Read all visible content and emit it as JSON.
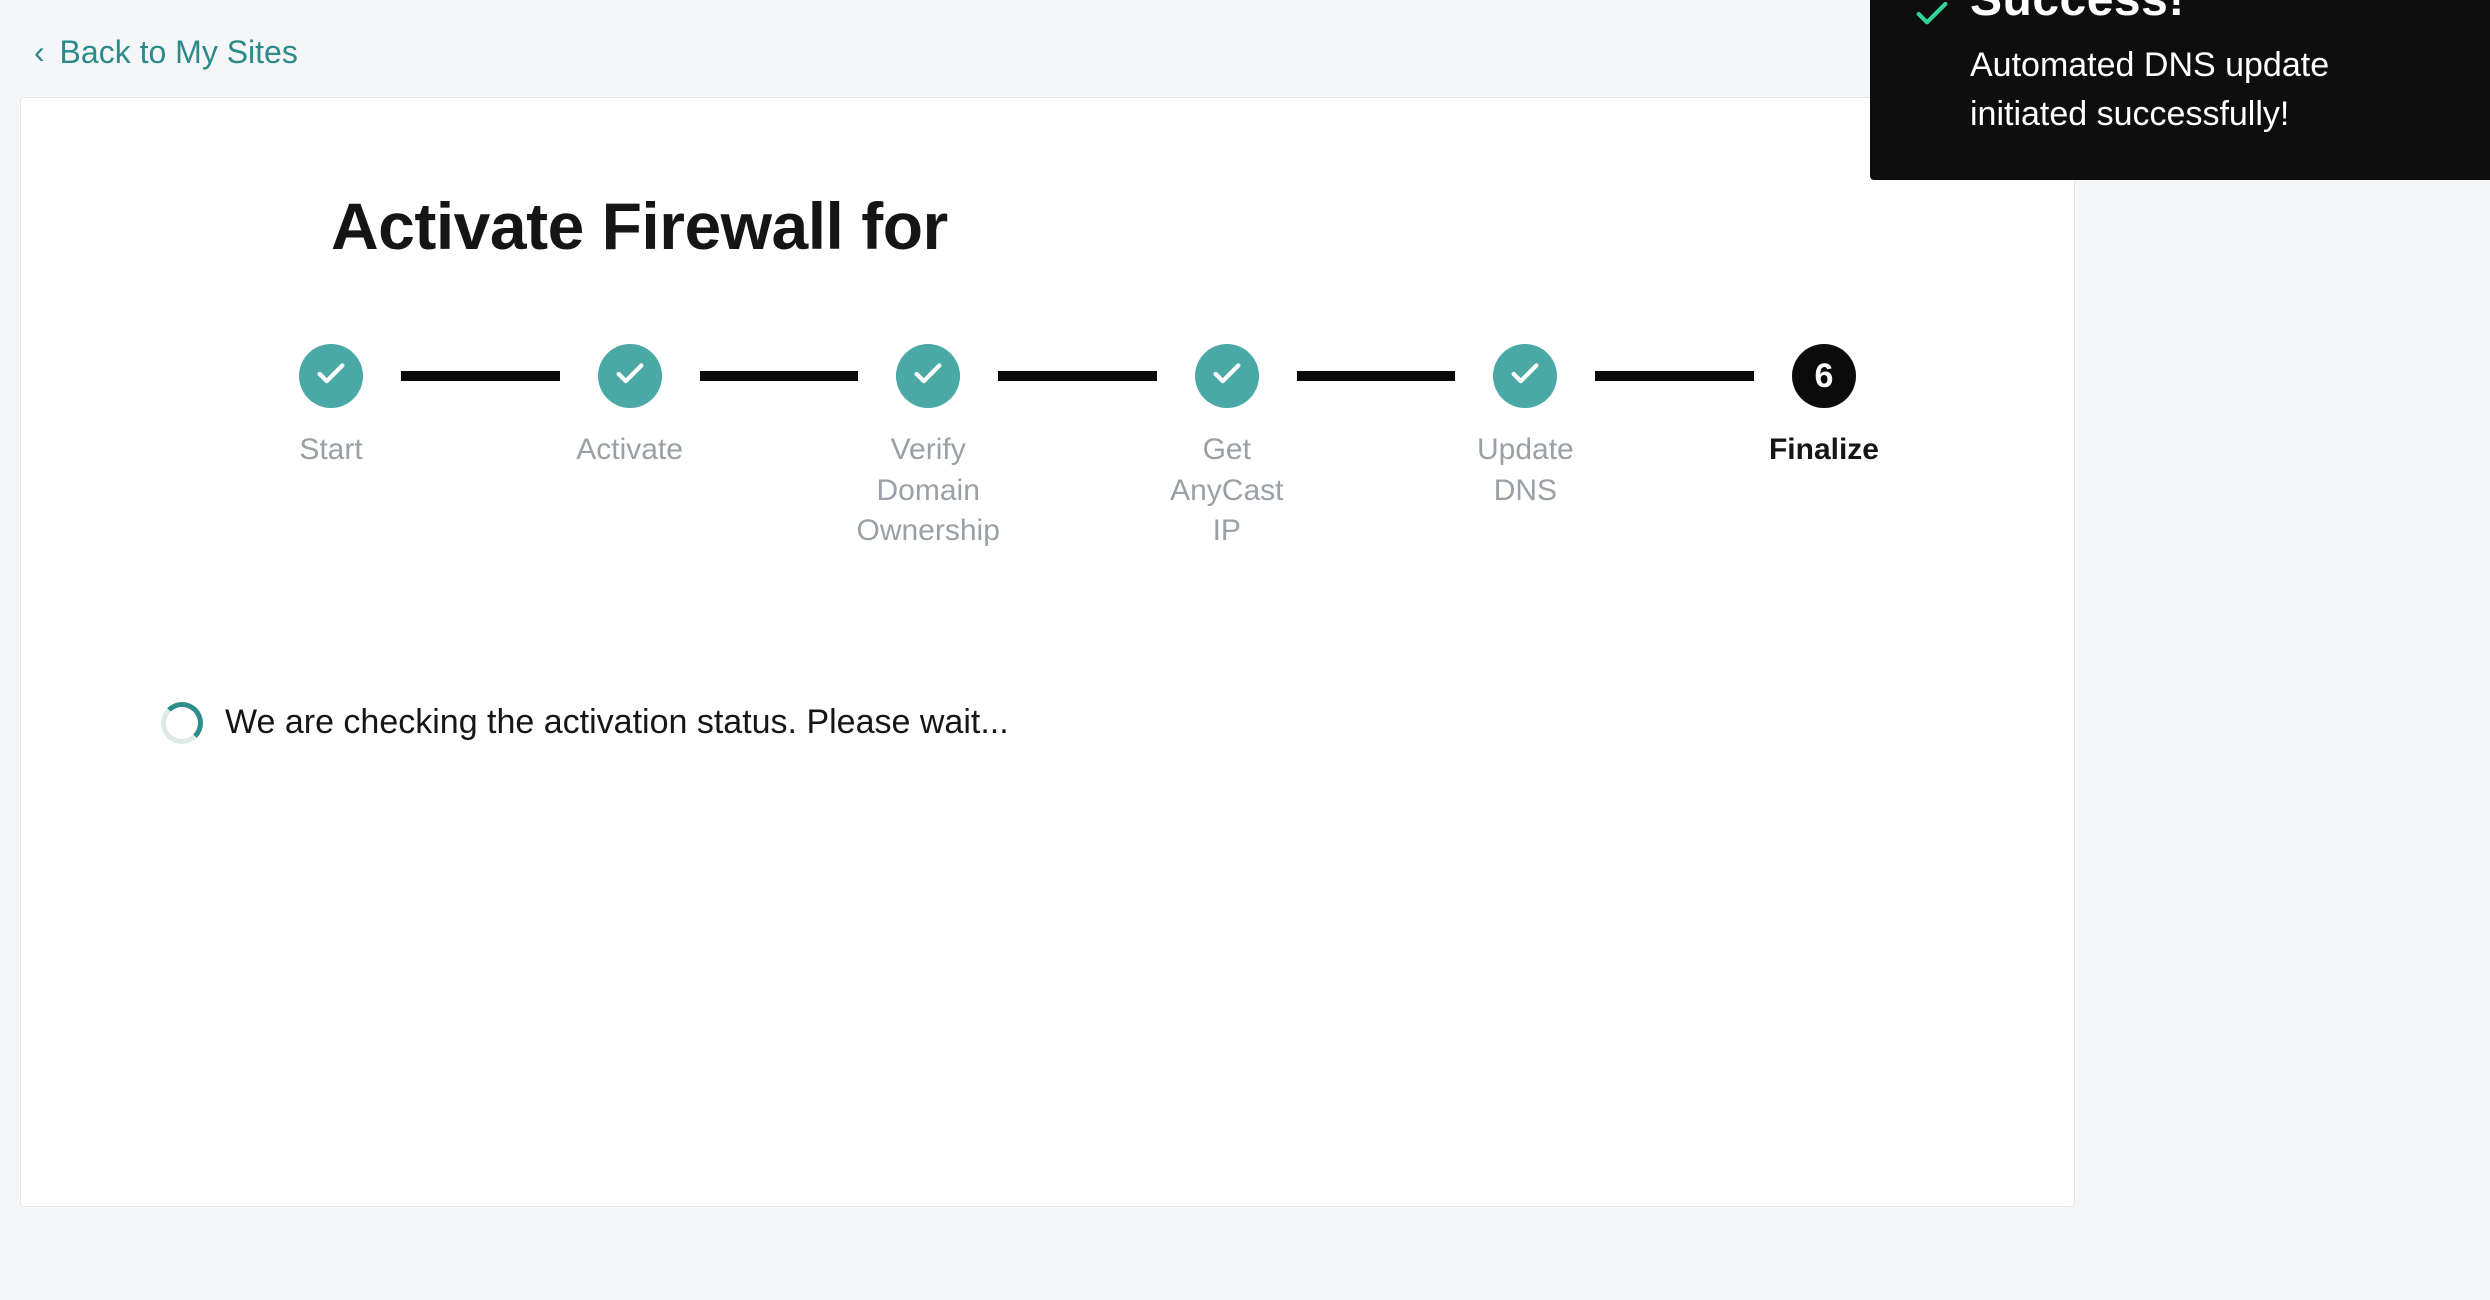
{
  "nav": {
    "back_label": "Back to My Sites"
  },
  "page": {
    "title": "Activate Firewall for"
  },
  "stepper": {
    "steps": [
      {
        "label": "Start",
        "state": "done"
      },
      {
        "label": "Activate",
        "state": "done"
      },
      {
        "label": "Verify Domain Ownership",
        "state": "done"
      },
      {
        "label": "Get AnyCast IP",
        "state": "done"
      },
      {
        "label": "Update DNS",
        "state": "done"
      },
      {
        "label": "Finalize",
        "state": "current",
        "number": "6"
      }
    ]
  },
  "status": {
    "message": "We are checking the activation status. Please wait..."
  },
  "toast": {
    "title": "Success!",
    "message": "Automated DNS update initiated successfully!"
  },
  "colors": {
    "accent_teal": "#4aa8a5",
    "link_teal": "#2b8a8a",
    "step_current_bg": "#0b0b0b",
    "page_bg": "#f5f6f8"
  }
}
